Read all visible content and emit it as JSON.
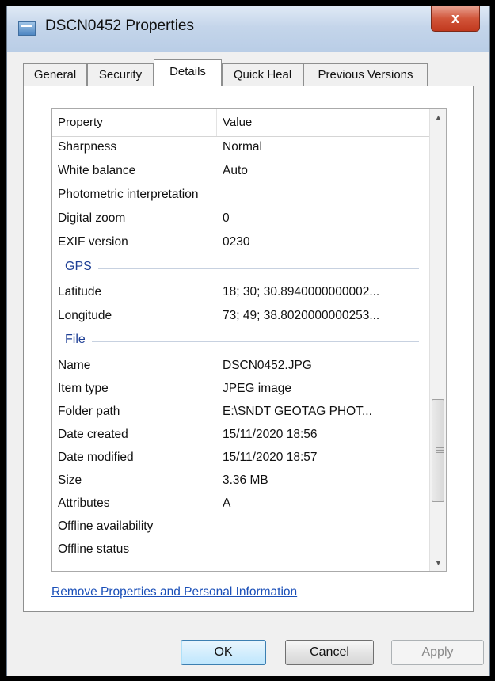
{
  "window": {
    "title": "DSCN0452 Properties",
    "close_label": "x"
  },
  "tabs": [
    {
      "label": "General"
    },
    {
      "label": "Security"
    },
    {
      "label": "Details"
    },
    {
      "label": "Quick Heal"
    },
    {
      "label": "Previous Versions"
    }
  ],
  "list": {
    "header_property": "Property",
    "header_value": "Value",
    "rows_top": [
      {
        "property": "Sharpness",
        "value": "Normal"
      },
      {
        "property": "White balance",
        "value": "Auto"
      },
      {
        "property": "Photometric interpretation",
        "value": ""
      },
      {
        "property": "Digital zoom",
        "value": "0"
      },
      {
        "property": "EXIF version",
        "value": "0230"
      }
    ],
    "group_gps": "GPS",
    "rows_gps": [
      {
        "property": "Latitude",
        "value": "18; 30; 30.8940000000002..."
      },
      {
        "property": "Longitude",
        "value": "73; 49; 38.8020000000253..."
      }
    ],
    "group_file": "File",
    "rows_file": [
      {
        "property": "Name",
        "value": "DSCN0452.JPG"
      },
      {
        "property": "Item type",
        "value": "JPEG image"
      },
      {
        "property": "Folder path",
        "value": "E:\\SNDT GEOTAG PHOT..."
      },
      {
        "property": "Date created",
        "value": "15/11/2020 18:56"
      },
      {
        "property": "Date modified",
        "value": "15/11/2020 18:57"
      },
      {
        "property": "Size",
        "value": "3.36 MB"
      },
      {
        "property": "Attributes",
        "value": "A"
      },
      {
        "property": "Offline availability",
        "value": ""
      },
      {
        "property": "Offline status",
        "value": ""
      }
    ]
  },
  "link_text": "Remove Properties and Personal Information",
  "buttons": {
    "ok": "OK",
    "cancel": "Cancel",
    "apply": "Apply"
  }
}
